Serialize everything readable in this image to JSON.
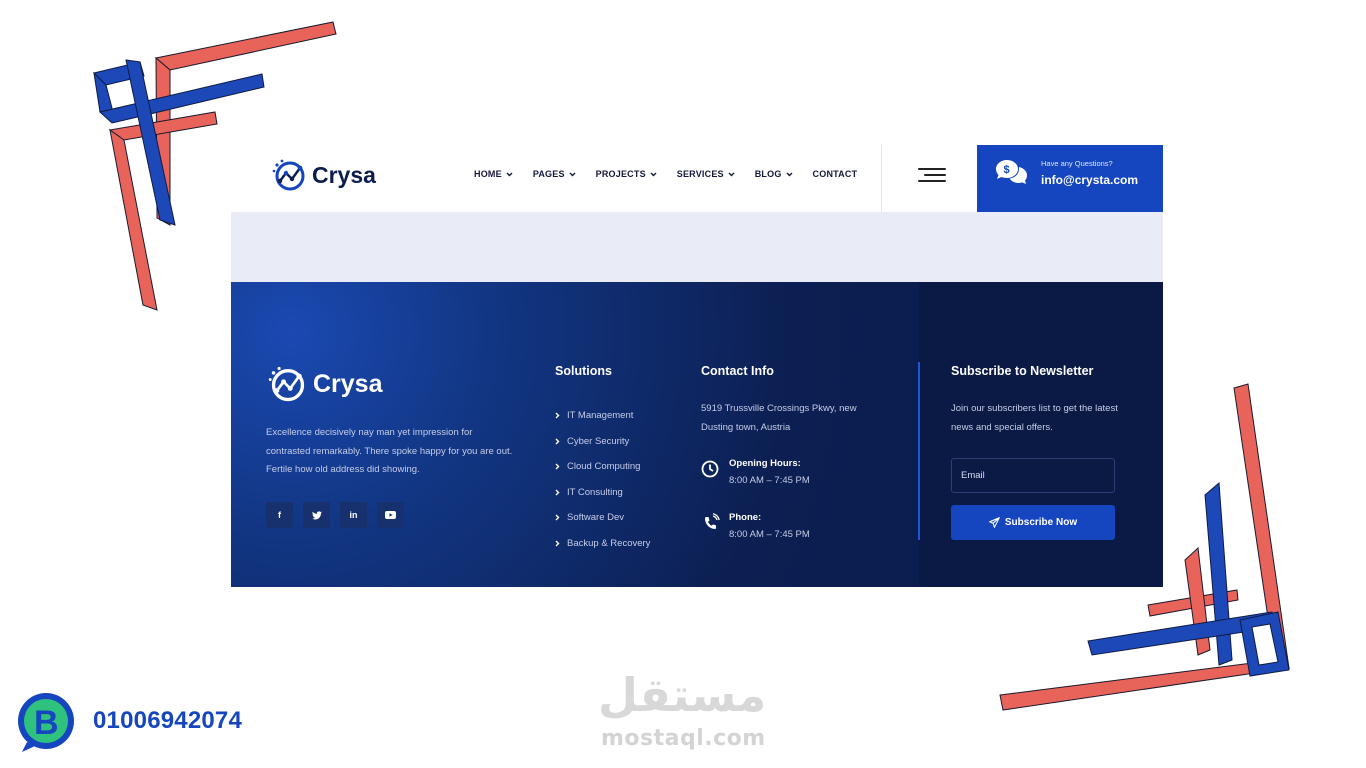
{
  "header": {
    "brand": "Crysa",
    "nav": [
      {
        "label": "HOME",
        "has_dropdown": true
      },
      {
        "label": "PAGES",
        "has_dropdown": true
      },
      {
        "label": "PROJECTS",
        "has_dropdown": true
      },
      {
        "label": "SERVICES",
        "has_dropdown": true
      },
      {
        "label": "BLOG",
        "has_dropdown": true
      },
      {
        "label": "CONTACT",
        "has_dropdown": false
      }
    ],
    "menu_icon": "hamburger-icon",
    "cta": {
      "icon": "chat-dollar-icon",
      "question": "Have any Questions?",
      "email": "info@crysta.com"
    }
  },
  "footer": {
    "brand": "Crysa",
    "about": "Excellence decisively nay man yet impression for contrasted remarkably. There spoke happy for you are out. Fertile how old address did showing.",
    "socials": [
      {
        "name": "facebook-icon",
        "glyph": "f"
      },
      {
        "name": "twitter-icon",
        "glyph": "t"
      },
      {
        "name": "linkedin-icon",
        "glyph": "in"
      },
      {
        "name": "youtube-icon",
        "glyph": "yt"
      }
    ],
    "solutions": {
      "title": "Solutions",
      "items": [
        "IT Management",
        "Cyber Security",
        "Cloud Computing",
        "IT Consulting",
        "Software Dev",
        "Backup & Recovery"
      ]
    },
    "contact": {
      "title": "Contact Info",
      "address": "5919 Trussville Crossings Pkwy, new Dusting town, Austria",
      "hours_label": "Opening Hours:",
      "hours_value": "8:00 AM – 7:45 PM",
      "phone_label": "Phone:",
      "phone_value": "8:00 AM – 7:45 PM"
    },
    "newsletter": {
      "title": "Subscribe to Newsletter",
      "text": "Join our subscribers list to get the latest news and special offers.",
      "placeholder": "Email",
      "value": "",
      "button": "Subscribe Now"
    }
  },
  "overlay": {
    "phone": "01006942074",
    "watermark_arabic": "مستقل",
    "watermark_latin": "mostaql.com"
  },
  "colors": {
    "accent": "#1546c0",
    "footer_bg": "#0b1c4a",
    "deco_red": "#e8645a",
    "deco_blue": "#1d48b8"
  }
}
